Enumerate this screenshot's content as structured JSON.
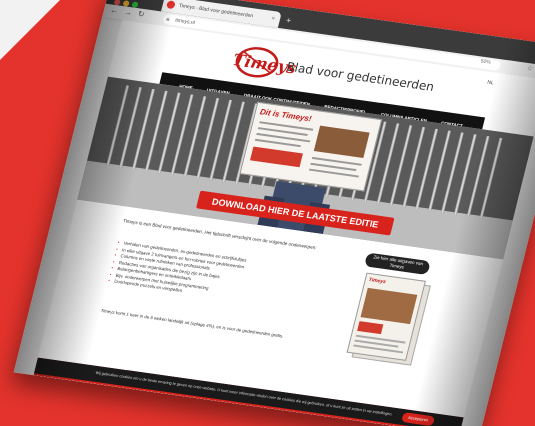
{
  "photo": {
    "background_color": "#e4332c",
    "accent": "#d8231c"
  },
  "browser": {
    "tab_title": "Timeys - Blad voor gedetineerden",
    "new_tab_icon": "plus-icon",
    "url": "timeys.nl",
    "zoom": "50%"
  },
  "site": {
    "logo_text": "Timeys",
    "tagline": "Blad voor gedetineerden",
    "language": "NL",
    "nav": [
      "HOME",
      "UITGAVEN",
      "DRAAIT OOK CONTINUTEIDEN",
      "REDACTIEPROFIEL",
      "COLUMNS ARTICLEN",
      "CONTACT"
    ],
    "hero": {
      "paper_headline": "Dit is Timeys!",
      "download_label": "DOWNLOAD HIER DE LAATSTE EDITIE"
    },
    "content": {
      "intro": "Timeys is een Blad voor gedetineerden. Het tijdschrift verschijnt over de volgende onderwerpen:",
      "bullets": [
        "Verhalen van gedetineerden, ex-gedetineerden en schrijfclubjes",
        "In elke uitgave 2 tuinvangers en fun-rubriek voor gedetineerden",
        "Columns en vaste rubrieken van professionals",
        "Redacties van organisaties die bezig zijn in de bajes",
        "Belangenbehartigers en ontwikkelaars",
        "Bijv. onderwerpen met huiselijke programmering",
        "Doorlopende puzzels en verspellen"
      ],
      "outro": "Timeys komt 1 keer in de 6 weken landelijk uit (oplage 4%), en is voor de gedetineerden gratis.",
      "side_pill": "Zie hier alle uitgaven van Timeys",
      "side_cover_title": "Timeys"
    },
    "cookie": {
      "text": "Wij gebruiken cookies om u de beste ervaring te geven op onze website. U kunt meer informatie vinden over de cookies die wij gebruiken, of u kunt ze uit zetten in uw instellingen.",
      "button": "Accepteren"
    }
  }
}
